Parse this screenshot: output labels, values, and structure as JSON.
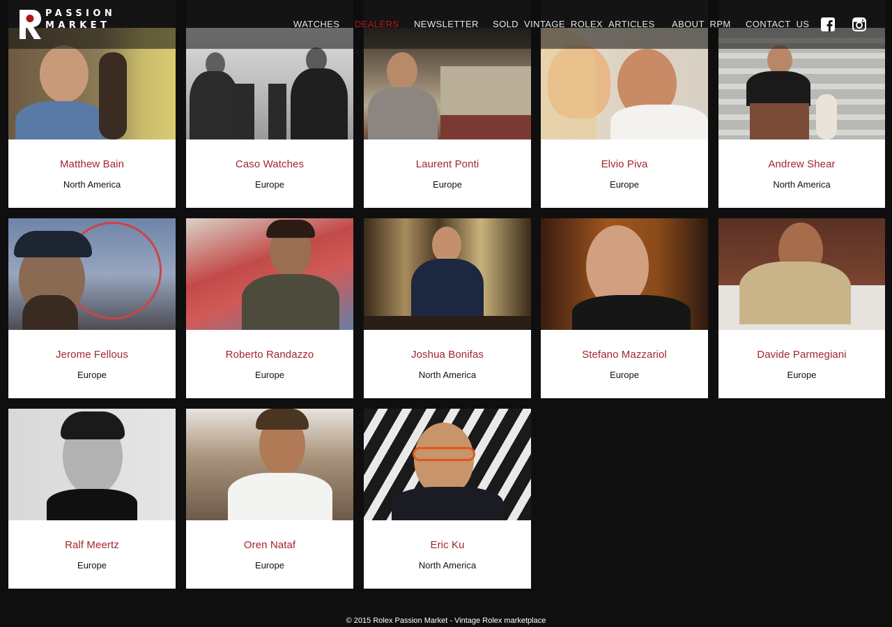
{
  "brand": {
    "logo_letter": "R",
    "logo_line1": "PASSION",
    "logo_line2": "MARKET"
  },
  "nav": {
    "items": [
      {
        "label": "WATCHES",
        "active": false
      },
      {
        "label": "DEALERS",
        "active": true
      },
      {
        "label": "NEWSLETTER",
        "active": false
      },
      {
        "label": "SOLD  VINTAGE  ROLEX",
        "active": false
      },
      {
        "label": "ARTICLES",
        "active": false
      },
      {
        "label": "ABOUT  RPM",
        "active": false
      },
      {
        "label": "CONTACT  US",
        "active": false
      }
    ],
    "social": [
      {
        "icon": "facebook-icon"
      },
      {
        "icon": "instagram-icon"
      }
    ]
  },
  "dealers": [
    {
      "name": "Matthew Bain",
      "region": "North America"
    },
    {
      "name": "Caso Watches",
      "region": "Europe"
    },
    {
      "name": "Laurent Ponti",
      "region": "Europe"
    },
    {
      "name": "Elvio Piva",
      "region": "Europe"
    },
    {
      "name": "Andrew Shear",
      "region": "North America"
    },
    {
      "name": "Jerome Fellous",
      "region": "Europe"
    },
    {
      "name": "Roberto Randazzo",
      "region": "Europe"
    },
    {
      "name": "Joshua Bonifas",
      "region": "North America"
    },
    {
      "name": "Stefano Mazzariol",
      "region": "Europe"
    },
    {
      "name": "Davide Parmegiani",
      "region": "Europe"
    },
    {
      "name": "Ralf Meertz",
      "region": "Europe"
    },
    {
      "name": "Oren Nataf",
      "region": "Europe"
    },
    {
      "name": "Eric Ku",
      "region": "North America"
    }
  ],
  "footer": {
    "text": "© 2015 Rolex Passion Market - Vintage Rolex marketplace"
  },
  "colors": {
    "accent": "#a3242c",
    "nav_active": "#b1161c",
    "background": "#0f0f0f"
  }
}
